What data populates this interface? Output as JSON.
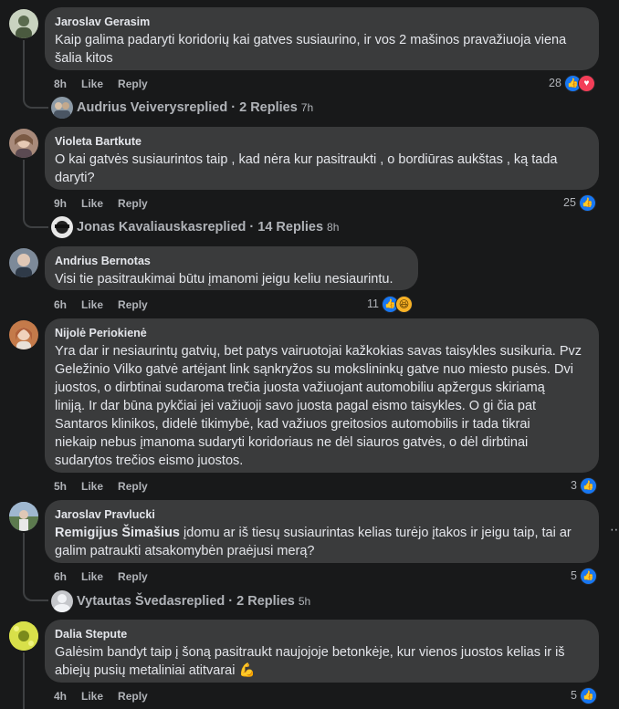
{
  "comments": [
    {
      "author": "Jaroslav Gerasim",
      "lines": [
        "Kaip galima padaryti koridorių kai gatves susiaurino, ir vos 2 mašinos pravažiuoja viena",
        "šalia kitos"
      ],
      "time": "8h",
      "like": "Like",
      "reply": "Reply",
      "count": "28",
      "reactions": [
        "like-icon",
        "love-icon"
      ],
      "avatar_color": "#c9d3c0"
    },
    {
      "author": "Violeta Bartkute",
      "lines": [
        "O kai gatvės susiaurintos taip , kad nėra kur pasitraukti , o bordiūras aukštas , ką tada",
        "daryti?"
      ],
      "time": "9h",
      "like": "Like",
      "reply": "Reply",
      "count": "25",
      "reactions": [
        "like-icon"
      ],
      "avatar_color": "#a88a7a"
    },
    {
      "author": "Andrius Bernotas",
      "lines": [
        "Visi tie pasitraukimai būtu įmanomi jeigu keliu nesiaurintu."
      ],
      "time": "6h",
      "like": "Like",
      "reply": "Reply",
      "count": "11",
      "reactions": [
        "like-icon",
        "haha-icon"
      ],
      "avatar_color": "#7d8a99"
    },
    {
      "author": "Nijolė Periokienė",
      "lines": [
        "Yra dar ir nesiaurintų gatvių, bet patys vairuotojai kažkokias savas taisykles susikuria. Pvz",
        "Geležinio Vilko gatvė artėjant link sąnkryžos su mokslininkų gatve nuo miesto pusės. Dvi",
        "juostos, o dirbtinai sudaroma trečia juosta važiuojant automobiliu apžergus skiriamą",
        "liniją. Ir dar būna pykčiai jei važiuoji savo juosta pagal eismo taisykles. O gi čia pat",
        "Santaros klinikos, didelė tikimybė, kad važiuos greitosios automobilis ir tada tikrai",
        "niekaip nebus įmanoma sudaryti koridoriaus ne dėl siauros gatvės, o dėl dirbtinai",
        "sudarytos trečios eismo juostos."
      ],
      "time": "5h",
      "like": "Like",
      "reply": "Reply",
      "count": "3",
      "reactions": [
        "like-icon"
      ],
      "avatar_color": "#c47a4a"
    },
    {
      "author": "Jaroslav Pravlucki",
      "mention": "Remigijus Šimašius",
      "lines": [
        " įdomu ar iš tiesų susiaurintas kelias turėjo įtakos ir jeigu taip, tai ar",
        "galim patraukti atsakomybėn praėjusi merą?"
      ],
      "time": "6h",
      "like": "Like",
      "reply": "Reply",
      "count": "5",
      "reactions": [
        "like-icon"
      ],
      "avatar_color": "#8aa0b8",
      "more": "⋯"
    },
    {
      "author": "Dalia Stepute",
      "lines": [
        "Galėsim bandyt taip į šoną pasitraukt naujojoje betonkėje, kur vienos juostos kelias ir iš",
        "abiejų pusių metaliniai atitvarai"
      ],
      "emoji": "💪",
      "time": "4h",
      "like": "Like",
      "reply": "Reply",
      "count": "5",
      "reactions": [
        "like-icon"
      ],
      "avatar_color": "#c8d83a"
    }
  ],
  "reply_threads": [
    {
      "name": "Audrius Veiverys",
      "label": " replied · 2 Replies",
      "time": "7h"
    },
    {
      "name": "Jonas Kavaliauskas",
      "label": " replied · 14 Replies",
      "time": "8h"
    },
    {
      "name": "Vytautas Švedas",
      "label": " replied · 2 Replies",
      "time": "5h"
    }
  ],
  "colors": {
    "background": "#18191a",
    "bubble": "#3a3b3c",
    "meta": "#b0b3b8",
    "like": "#1877f2",
    "love": "#f33e58"
  }
}
